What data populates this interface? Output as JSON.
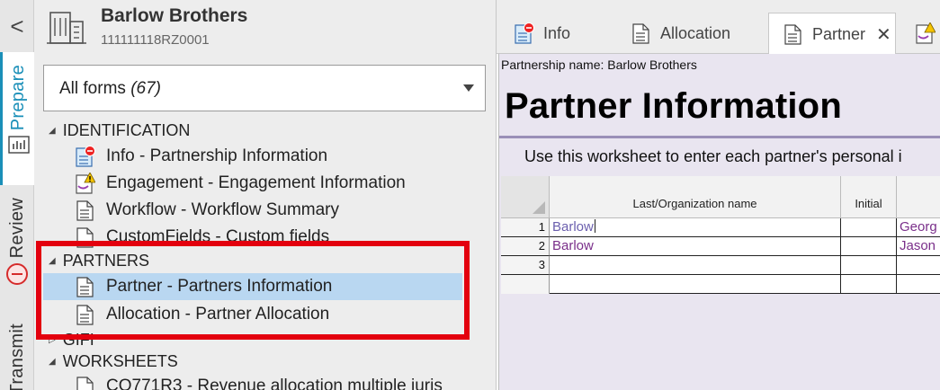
{
  "rail": {
    "collapse_glyph": "<",
    "tabs": [
      {
        "label": "Prepare",
        "active": true,
        "icon": "chart-icon"
      },
      {
        "label": "Review",
        "active": false,
        "icon": "review-error-icon"
      },
      {
        "label": "Transmit",
        "active": false,
        "icon": ""
      }
    ]
  },
  "client": {
    "name": "Barlow Brothers",
    "id": "111111118RZ0001"
  },
  "forms_filter": {
    "label": "All forms",
    "count": "(67)"
  },
  "tree": {
    "sections": [
      {
        "title": "IDENTIFICATION",
        "expanded": true
      },
      {
        "title": "PARTNERS",
        "expanded": true
      },
      {
        "title": "GIFI",
        "expanded": false
      },
      {
        "title": "WORKSHEETS",
        "expanded": true
      }
    ],
    "identification_items": [
      {
        "label": "Info - Partnership Information",
        "icon": "form-error-icon"
      },
      {
        "label": "Engagement - Engagement Information",
        "icon": "form-warning-icon"
      },
      {
        "label": "Workflow - Workflow Summary",
        "icon": "document-icon"
      },
      {
        "label": "CustomFields - Custom fields",
        "icon": "document-icon"
      }
    ],
    "partners_items": [
      {
        "label": "Partner - Partners Information",
        "icon": "document-icon",
        "selected": true
      },
      {
        "label": "Allocation - Partner Allocation",
        "icon": "document-icon",
        "selected": false
      }
    ],
    "worksheets_items": [
      {
        "label": "CO771R3 - Revenue allocation multiple juris",
        "icon": "document-icon"
      }
    ]
  },
  "tabs": [
    {
      "label": "Info",
      "icon": "form-error-icon",
      "active": false
    },
    {
      "label": "Allocation",
      "icon": "document-icon",
      "active": false
    },
    {
      "label": "Partner",
      "icon": "document-icon",
      "active": true,
      "close_glyph": "✕"
    }
  ],
  "worksheet": {
    "partnership_line": "Partnership name: Barlow Brothers",
    "title": "Partner Information",
    "instructions": "Use this worksheet to enter each partner's personal i",
    "columns": [
      "Last/Organization name",
      "Initial",
      ""
    ],
    "rows": [
      {
        "num": "1",
        "last": "Barlow",
        "initial": "",
        "first": "Georg"
      },
      {
        "num": "2",
        "last": "Barlow",
        "initial": "",
        "first": "Jason"
      },
      {
        "num": "3",
        "last": "",
        "initial": "",
        "first": ""
      },
      {
        "num": "",
        "last": "",
        "initial": "",
        "first": ""
      }
    ]
  },
  "colors": {
    "accent": "#1a8fb8",
    "selection": "#b9d7f1",
    "highlight_border": "#e3000e",
    "worksheet_bg": "#e9e5f0",
    "cell_text": "#7a2f8a"
  }
}
